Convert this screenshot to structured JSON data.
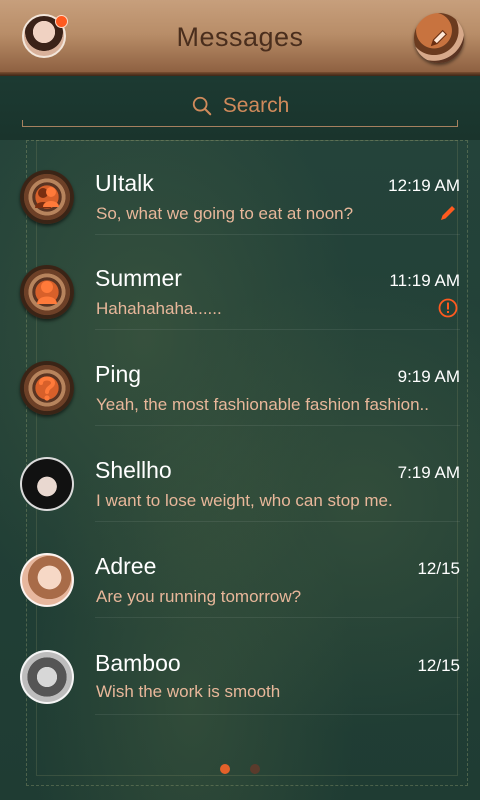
{
  "header": {
    "title": "Messages",
    "notification_color": "#ff5a1f",
    "compose_icon": "pencil-icon"
  },
  "search": {
    "label": "Search",
    "icon": "search-icon"
  },
  "conversations": [
    {
      "name": "UItalk",
      "time": "12:19 AM",
      "snippet": "So, what we going to eat at noon?",
      "avatar": "group-contact-icon",
      "status": "draft-pencil-icon"
    },
    {
      "name": "Summer",
      "time": "11:19 AM",
      "snippet": "Hahahahaha......",
      "avatar": "contact-icon",
      "status": "error-icon"
    },
    {
      "name": "Ping",
      "time": "9:19 AM",
      "snippet": "Yeah, the most fashionable fashion fashion..",
      "avatar": "unknown-contact-icon",
      "status": ""
    },
    {
      "name": "Shellho",
      "time": "7:19 AM",
      "snippet": "I want to lose weight, who can stop me.",
      "avatar": "photo",
      "status": ""
    },
    {
      "name": "Adree",
      "time": "12/15",
      "snippet": "Are you running tomorrow?",
      "avatar": "photo",
      "status": ""
    },
    {
      "name": "Bamboo",
      "time": "12/15",
      "snippet": "Wish the work is smooth",
      "avatar": "photo",
      "status": ""
    }
  ],
  "pager": {
    "pages": 2,
    "active_page": 1
  },
  "colors": {
    "accent": "#e3612a",
    "snippet": "#e8b79a",
    "background": "#1f3a31"
  }
}
